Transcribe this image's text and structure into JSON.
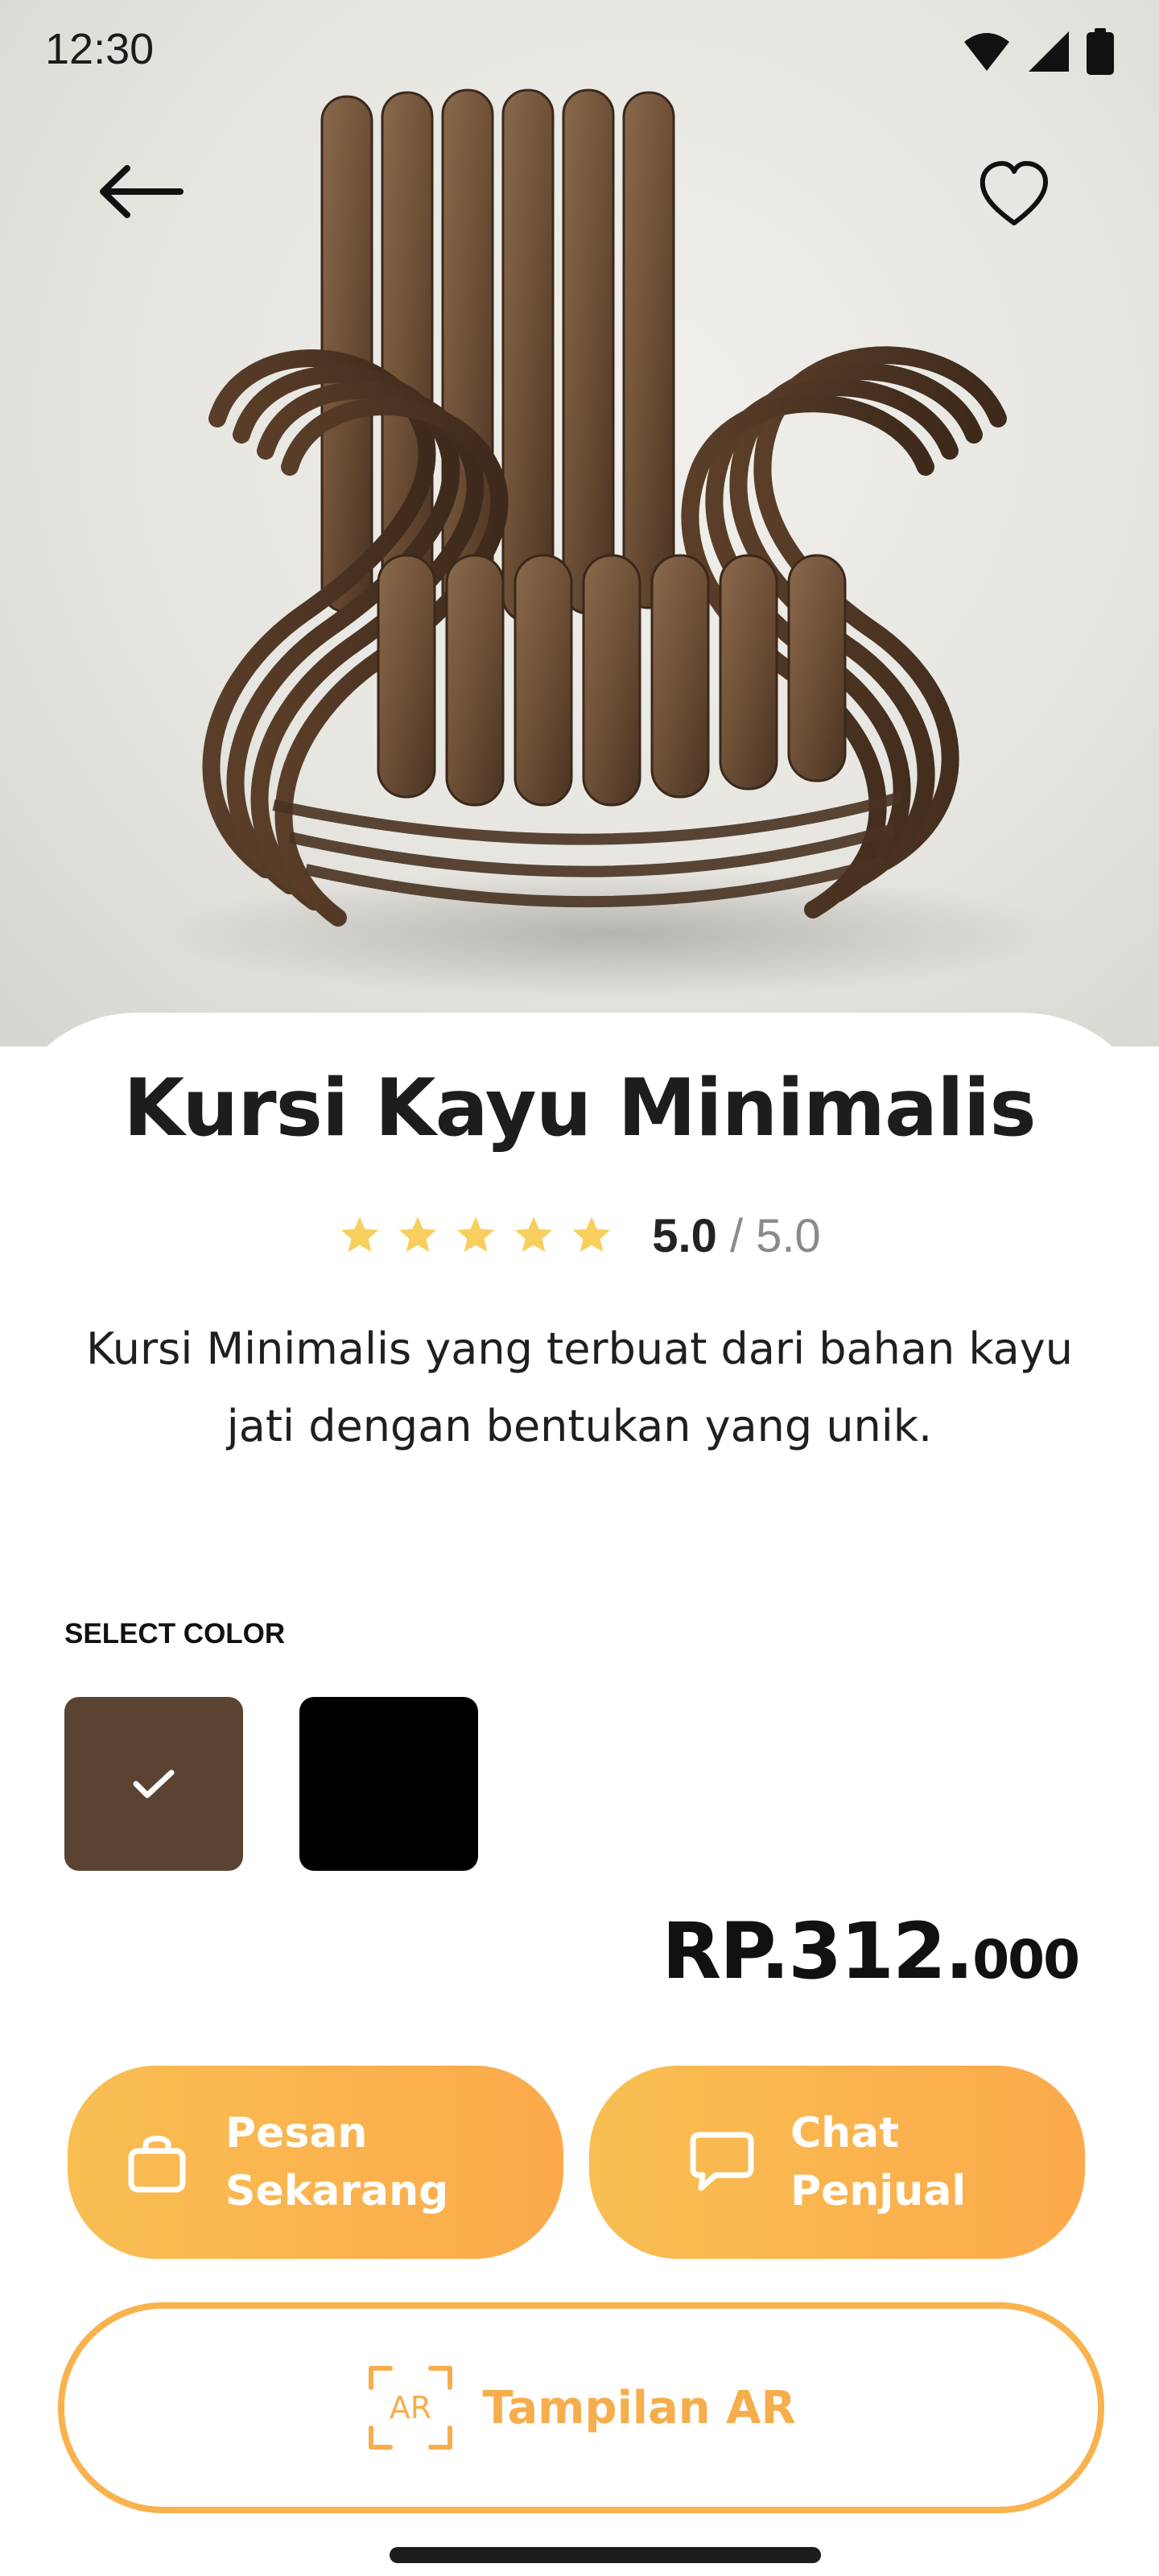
{
  "status_bar": {
    "time": "12:30",
    "icons": [
      "wifi-icon",
      "signal-icon",
      "battery-icon"
    ]
  },
  "nav": {
    "back_icon": "arrow-left-icon",
    "favorite_icon": "heart-icon"
  },
  "hero": {
    "image": "wooden-bentwood-armchair"
  },
  "product": {
    "title": "Kursi Kayu Minimalis",
    "rating": {
      "stars": 5,
      "value": "5.0",
      "separator": "/",
      "max": "5.0"
    },
    "description": "Kursi Minimalis yang terbuat dari bahan kayu jati dengan bentukan yang unik."
  },
  "color_picker": {
    "label": "SELECT COLOR",
    "options": [
      {
        "name": "brown",
        "hex": "#5b4332",
        "selected": true
      },
      {
        "name": "black",
        "hex": "#000000",
        "selected": false
      }
    ]
  },
  "price": {
    "main": "RP.312.",
    "cents": "000"
  },
  "actions": {
    "order": {
      "line1": "Pesan",
      "line2": "Sekarang",
      "icon": "shopping-bag-icon"
    },
    "chat": {
      "line1": "Chat",
      "line2": "Penjual",
      "icon": "chat-bubble-icon"
    },
    "ar": {
      "label": "Tampilan AR",
      "icon_text": "AR",
      "icon": "ar-scan-icon"
    }
  },
  "colors": {
    "accent": "#f9b24e",
    "accent_gradient_start": "#f8be52",
    "accent_gradient_end": "#fcaa4b",
    "star": "#f8cf5e",
    "text_primary": "#1d1d1d",
    "text_muted": "#8a8a8a"
  }
}
